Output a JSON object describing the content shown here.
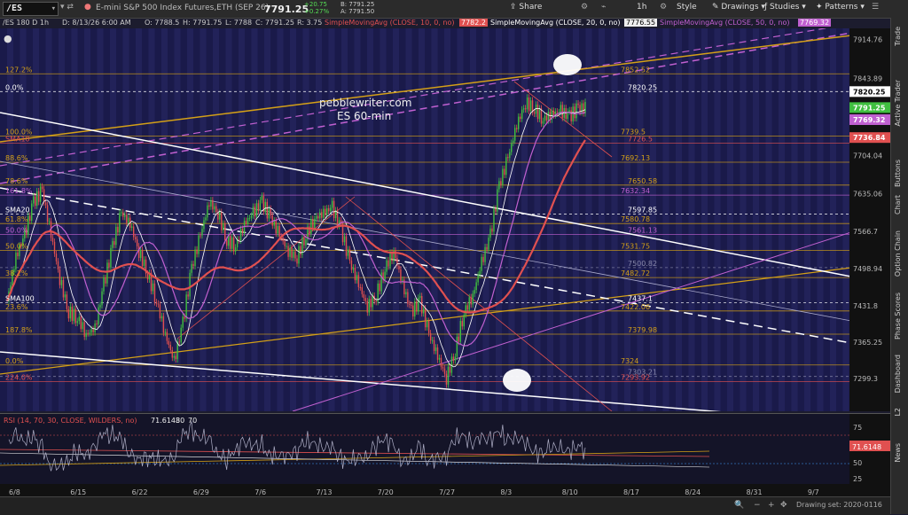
{
  "toolbar": {
    "symbol": "/ES",
    "symbol_suffix": "▾",
    "description": "E-mini S&P 500 Index Futures,ETH (SEP 26)",
    "last_price": "7791.25",
    "change": "+20.75",
    "change_pct": "+0.27%",
    "bid": "B: 7791.25",
    "ask": "A: 7791.50",
    "share": "Share",
    "interval": "1h",
    "style": "Style",
    "drawings": "Drawings",
    "studies": "Studies",
    "patterns": "Patterns"
  },
  "infobar": {
    "symbol_period": "/ES 180 D 1h",
    "date": "D: 8/13/26 6:00 AM",
    "open": "O: 7788.5",
    "high": "H: 7791.75",
    "low": "L: 7788",
    "close": "C: 7791.25",
    "range": "R: 3.75",
    "sma10_label": "SimpleMovingAvg (CLOSE, 10, 0, no)",
    "sma10_value": "7782.2",
    "sma20_label": "SimpleMovingAvg (CLOSE, 20, 0, no)",
    "sma20_value": "7776.55",
    "sma50_label": "SimpleMovingAvg (CLOSE, 50, 0, no)",
    "sma50_value": "7769.32"
  },
  "right_panel": [
    "Trade",
    "Active Trader",
    "Buttons",
    "Chart",
    "Option Chain",
    "Phase Scores",
    "Dashboard",
    "L2",
    "News"
  ],
  "watermark": {
    "line1": "pebblewriter.com",
    "line2": "ES 60-min"
  },
  "colors": {
    "background": "#1a1a4a",
    "fib": "#d4a017",
    "magenta": "#c060d0",
    "sma_red": "#e05050",
    "price_green": "#40c040",
    "white": "#ffffff"
  },
  "chart_data": {
    "type": "candlestick",
    "title": "/ES 180 D 1h",
    "price_axis_ticks": [
      "7914.76",
      "7843.89",
      "7774.1",
      "7704.04",
      "7635.06",
      "7566.7",
      "7498.94",
      "7431.8",
      "7365.25",
      "7299.3"
    ],
    "x_tick_labels": [
      "6/8",
      "6/15",
      "6/22",
      "6/29",
      "7/6",
      "7/13",
      "7/20",
      "7/27",
      "8/3",
      "8/10",
      "8/17",
      "8/24",
      "8/31",
      "9/7"
    ],
    "ylim": [
      7240,
      7935
    ],
    "last_price": 7791.25,
    "price_markers": [
      {
        "label": "7820.25",
        "value": 7820.25,
        "color": "#ffffff"
      },
      {
        "label": "7791.25",
        "value": 7791.25,
        "color": "#40c040"
      },
      {
        "label": "7769.32",
        "value": 7769.32,
        "color": "#c060d0"
      },
      {
        "label": "7736.84",
        "value": 7736.84,
        "color": "#e05050"
      }
    ],
    "horizontal_levels": [
      {
        "label": "7852.52",
        "value": 7852.52,
        "color": "#d4a017",
        "fib": "127.2%"
      },
      {
        "label": "7820.25",
        "value": 7820.25,
        "color": "#ffffff",
        "fib": "0.0%"
      },
      {
        "label": "7739.5",
        "value": 7739.5,
        "color": "#d4a017",
        "fib": "100.0%"
      },
      {
        "label": "7726.5",
        "value": 7726.5,
        "color": "#e05050",
        "fib": "SMA10"
      },
      {
        "label": "7692.13",
        "value": 7692.13,
        "color": "#d4a017",
        "fib": "88.6%"
      },
      {
        "label": "7650.58",
        "value": 7650.58,
        "color": "#d4a017",
        "fib": "78.6%"
      },
      {
        "label": "7632.34",
        "value": 7632.34,
        "color": "#c060d0",
        "fib": "161.8%"
      },
      {
        "label": "7597.85",
        "value": 7597.85,
        "color": "#ffffff",
        "fib": "SMA20"
      },
      {
        "label": "7580.78",
        "value": 7580.78,
        "color": "#d4a017",
        "fib": "61.8%"
      },
      {
        "label": "7561.13",
        "value": 7561.13,
        "color": "#c060d0",
        "fib": "50.0%"
      },
      {
        "label": "7531.75",
        "value": 7531.75,
        "color": "#d4a017",
        "fib": "50.0%"
      },
      {
        "label": "7500.82",
        "value": 7500.82,
        "color": "#8888aa",
        "fib": ""
      },
      {
        "label": "7482.72",
        "value": 7482.72,
        "color": "#d4a017",
        "fib": "38.2%"
      },
      {
        "label": "7437.1",
        "value": 7437.1,
        "color": "#ffffff",
        "fib": "SMA100"
      },
      {
        "label": "7422.06",
        "value": 7422.06,
        "color": "#d4a017",
        "fib": "23.6%"
      },
      {
        "label": "7379.98",
        "value": 7379.98,
        "color": "#d4a017",
        "fib": "187.8%"
      },
      {
        "label": "7324",
        "value": 7324,
        "color": "#d4a017",
        "fib": "0.0%"
      },
      {
        "label": "7303.21",
        "value": 7303.21,
        "color": "#8888aa",
        "fib": ""
      },
      {
        "label": "7293.92",
        "value": 7293.92,
        "color": "#e05050",
        "fib": "224.0%"
      }
    ],
    "close_series": [
      7440,
      7520,
      7560,
      7620,
      7640,
      7560,
      7480,
      7420,
      7410,
      7380,
      7390,
      7470,
      7540,
      7600,
      7580,
      7530,
      7490,
      7440,
      7380,
      7330,
      7400,
      7500,
      7560,
      7620,
      7600,
      7550,
      7540,
      7580,
      7600,
      7620,
      7590,
      7560,
      7530,
      7520,
      7560,
      7590,
      7600,
      7610,
      7570,
      7510,
      7470,
      7430,
      7450,
      7500,
      7530,
      7470,
      7420,
      7440,
      7380,
      7340,
      7300,
      7350,
      7420,
      7450,
      7510,
      7560,
      7650,
      7700,
      7760,
      7800,
      7790,
      7770,
      7780,
      7785,
      7775,
      7790,
      7791
    ],
    "rsi": {
      "label": "RSI (14, 70, 30, CLOSE, WILDERS, no)",
      "value": "71.6148",
      "overbought": "30",
      "oversold": "70",
      "ticks": [
        "75",
        "50",
        "25"
      ]
    }
  },
  "bottom": {
    "drawing_set": "Drawing set: 2020-0116"
  }
}
